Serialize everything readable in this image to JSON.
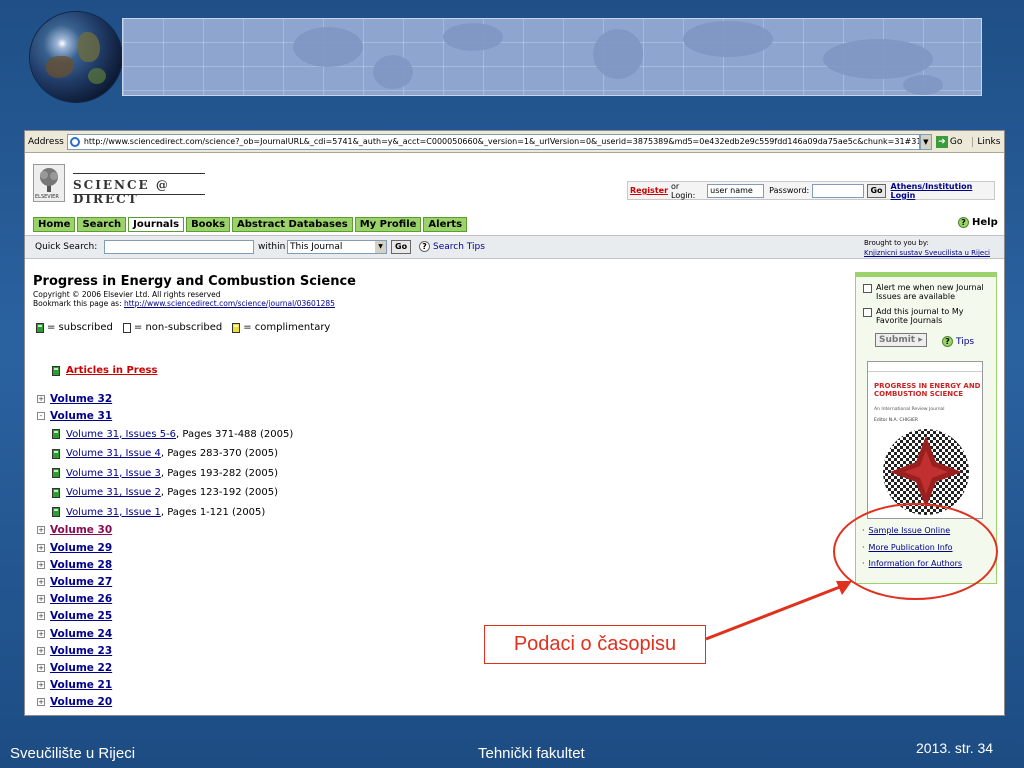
{
  "slide": {
    "footer_left": "Sveučilište u Rijeci",
    "footer_center": "Tehnički fakultet",
    "footer_right": "2013.  str. 34",
    "callout": "Podaci o časopisu",
    "accent_color": "#e0301e"
  },
  "browser": {
    "address_label": "Address",
    "url": "http://www.sciencedirect.com/science?_ob=JournalURL&_cdi=5741&_auth=y&_acct=C000050660&_version=1&_urlVersion=0&_userid=3875389&md5=0e432edb2e9c559fdd146a09da75ae5c&chunk=31#31",
    "go_label": "Go",
    "links_label": "Links"
  },
  "site": {
    "logo_wordmark": "SCIENCE @ DIRECT",
    "publisher": "ELSEVIER",
    "login": {
      "register": "Register",
      "or_login": "or Login:",
      "username_value": "user name",
      "password_label": "Password:",
      "go": "Go",
      "athens": "Athens/Institution Login"
    },
    "nav": [
      "Home",
      "Search",
      "Journals",
      "Books",
      "Abstract Databases",
      "My Profile",
      "Alerts"
    ],
    "nav_active": "Journals",
    "help": "Help",
    "quick_search": {
      "label": "Quick Search:",
      "within": "within",
      "scope": "This Journal",
      "go": "Go",
      "tips": "Search Tips"
    },
    "brought_by": "Brought to you by:",
    "library": "Knjiznicni sustav Sveucilista u Rijeci"
  },
  "journal": {
    "title": "Progress in Energy and Combustion Science",
    "copyright": "Copyright © 2006 Elsevier Ltd. All rights reserved",
    "bookmark_label": "Bookmark this page as:",
    "bookmark_url": "http://www.sciencedirect.com/science/journal/03601285",
    "legend": {
      "subscribed": "= subscribed",
      "non_subscribed": "= non-subscribed",
      "complimentary": "= complimentary"
    },
    "articles_in_press": "Articles in Press",
    "volumes_top": [
      {
        "label": "Volume 32",
        "state": "+"
      },
      {
        "label": "Volume 31",
        "state": "-"
      }
    ],
    "issues": [
      {
        "label": "Volume 31, Issues 5-6",
        "pages": ", Pages 371-488 (2005)"
      },
      {
        "label": "Volume 31, Issue 4",
        "pages": ", Pages 283-370 (2005)"
      },
      {
        "label": "Volume 31, Issue 3",
        "pages": ", Pages 193-282 (2005)"
      },
      {
        "label": "Volume 31, Issue 2",
        "pages": ", Pages 123-192 (2005)"
      },
      {
        "label": "Volume 31, Issue 1",
        "pages": ", Pages 1-121 (2005)"
      }
    ],
    "volumes_bottom": [
      {
        "label": "Volume 30",
        "state": "+",
        "visited": true
      },
      {
        "label": "Volume 29",
        "state": "+"
      },
      {
        "label": "Volume 28",
        "state": "+"
      },
      {
        "label": "Volume 27",
        "state": "+"
      },
      {
        "label": "Volume 26",
        "state": "+"
      },
      {
        "label": "Volume 25",
        "state": "+"
      },
      {
        "label": "Volume 24",
        "state": "+"
      },
      {
        "label": "Volume 23",
        "state": "+"
      },
      {
        "label": "Volume 22",
        "state": "+"
      },
      {
        "label": "Volume 21",
        "state": "+"
      },
      {
        "label": "Volume 20",
        "state": "+"
      }
    ]
  },
  "sidebar": {
    "alert_option": "Alert me when new Journal Issues are available",
    "favorite_option": "Add this journal to My Favorite Journals",
    "submit": "Submit",
    "tips": "Tips",
    "cover": {
      "title": "PROGRESS IN ENERGY AND COMBUSTION SCIENCE",
      "subtitle": "An International Review Journal",
      "editor": "Editor  N.A. CHIGIER"
    },
    "links": [
      "Sample Issue Online",
      "More Publication Info",
      "Information for Authors"
    ]
  }
}
